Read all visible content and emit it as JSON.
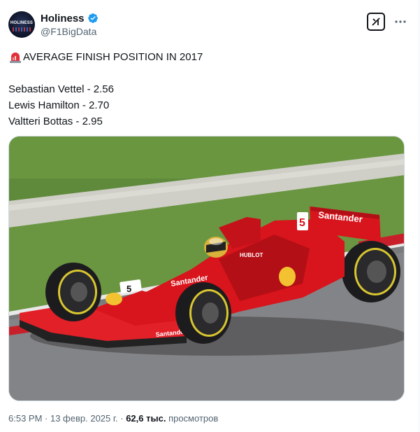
{
  "author": {
    "display_name": "Holiness",
    "handle": "@F1BigData",
    "avatar_text": "HOLINESS",
    "verified": true
  },
  "tweet": {
    "headline_icon": "rotating-light-icon",
    "headline": "AVERAGE FINISH POSITION IN 2017",
    "lines": [
      "Sebastian Vettel - 2.56",
      "Lewis Hamilton - 2.70",
      "Valtteri Bottas - 2.95"
    ]
  },
  "media": {
    "car_number": "5",
    "sponsor_text": "Santander",
    "sponsor_text_nose": "Santander",
    "engine_cover_text": "HUBLOT"
  },
  "footer": {
    "time": "6:53 PM",
    "separator": " · ",
    "date": "13 февр. 2025 г.",
    "views_count": "62,6 тыс.",
    "views_label": "просмотров"
  },
  "colors": {
    "accent_verified": "#1d9bf0",
    "ferrari_red": "#d8141c",
    "text_secondary": "#536471"
  }
}
